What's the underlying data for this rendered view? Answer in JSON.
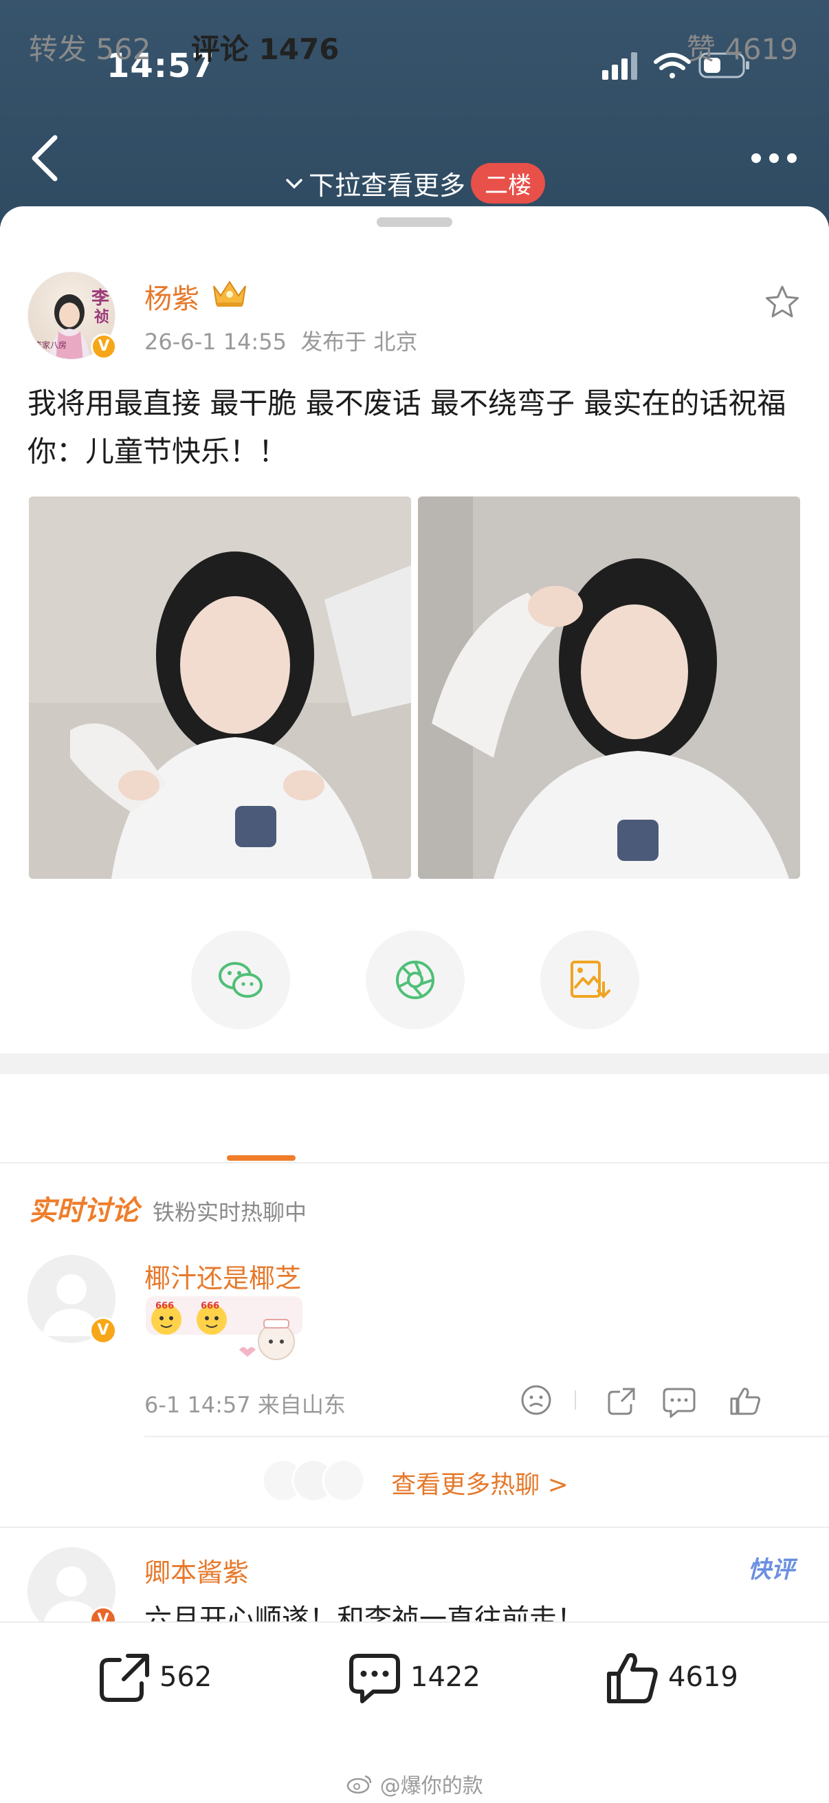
{
  "status_bar": {
    "time": "14:57"
  },
  "header": {
    "pull_hint": "下拉查看更多",
    "floor_badge": "二楼"
  },
  "post": {
    "author": "杨紫",
    "timestamp": "26-6-1 14:55",
    "location": "发布于 北京",
    "text": "我将用最直接 最干脆 最不废话 最不绕弯子 最实在的话祝福你：儿童节快乐！！",
    "avatar_text": "李祯"
  },
  "tabs": {
    "forward": "转发 562",
    "comment": "评论 1476",
    "like": "赞 4619"
  },
  "realtime": {
    "title": "实时讨论",
    "subtitle": "铁粉实时热聊中"
  },
  "comments": [
    {
      "name": "椰汁还是椰芝",
      "time": "6-1 14:57  来自山东"
    },
    {
      "name": "卿本酱紫",
      "text": "六月开心顺遂！和李祯一直往前走！",
      "tag": "快评"
    }
  ],
  "more_hot": "查看更多热聊 >",
  "bottom_bar": {
    "repost_count": "562",
    "comment_count": "1422",
    "like_count": "4619"
  },
  "watermark": "@爆你的款",
  "colors": {
    "accent": "#e6792b",
    "header_bg": "#33506a",
    "badge_red": "#e8504a",
    "verified": "#f7a617"
  }
}
